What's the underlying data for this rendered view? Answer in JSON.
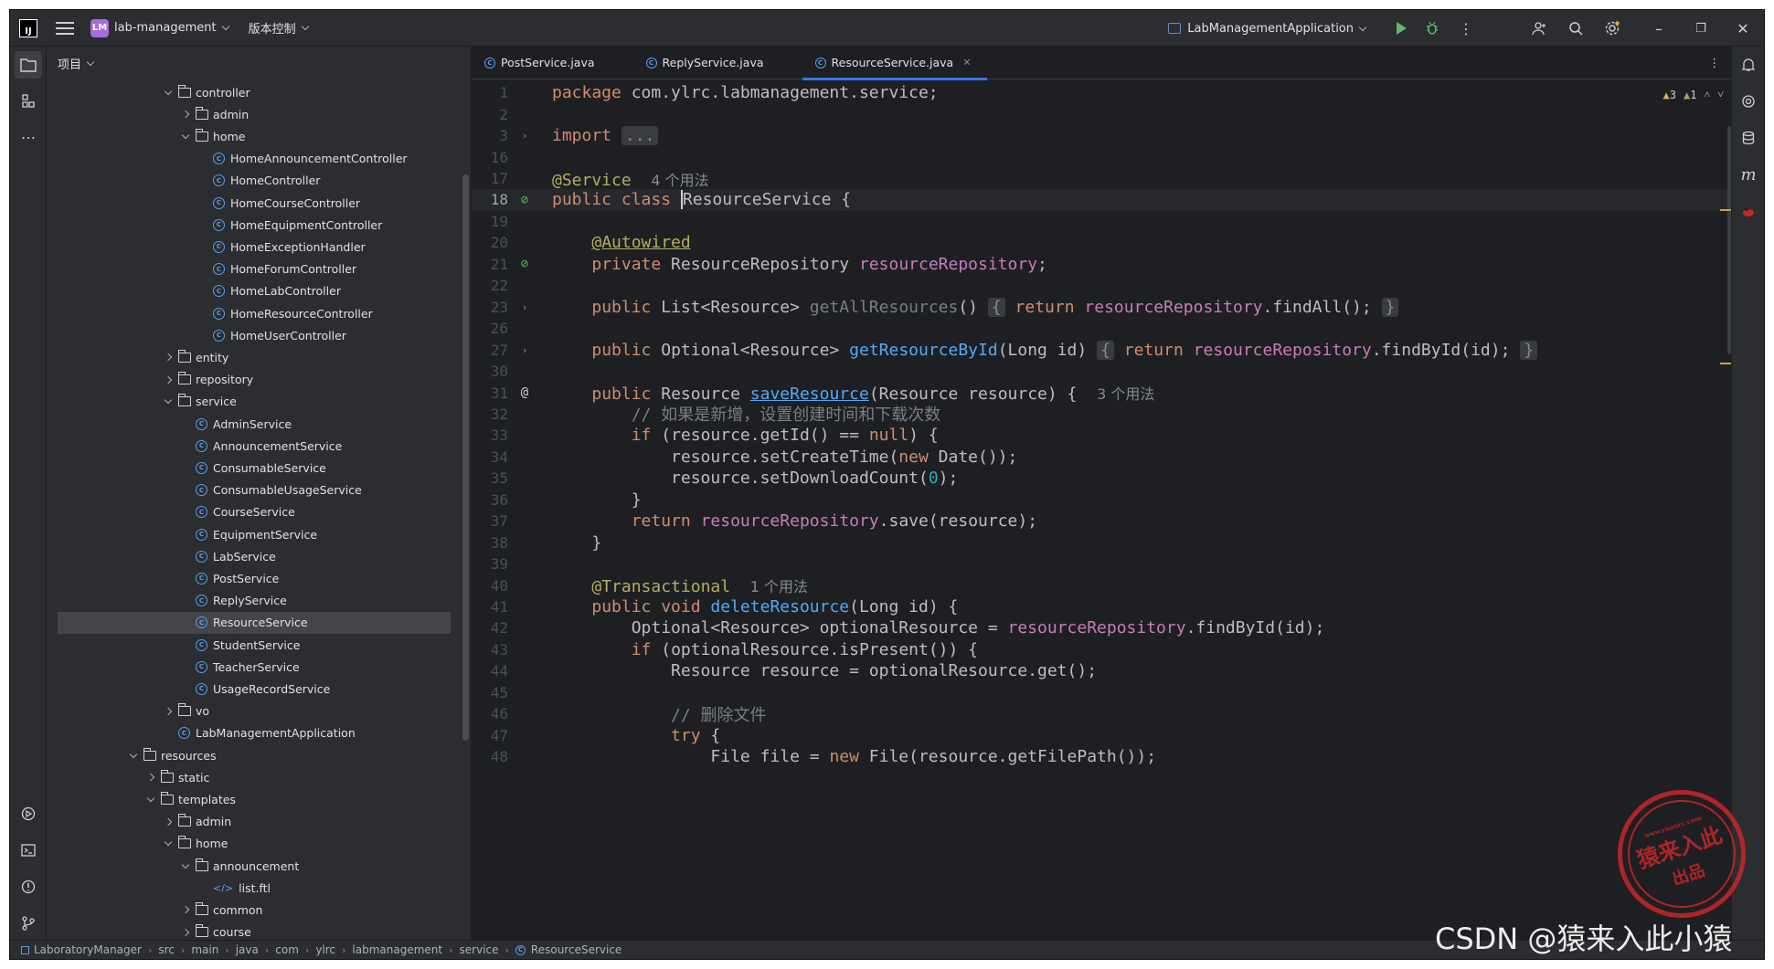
{
  "titlebar": {
    "app_logo": "IJ",
    "project_badge": "LM",
    "project_name": "lab-management",
    "vcs_menu": "版本控制",
    "run_config": "LabManagementApplication",
    "icons": [
      "menu-icon",
      "run-icon",
      "debug-icon",
      "more-icon",
      "user-icon",
      "search-icon",
      "settings-icon",
      "minimize-icon",
      "maximize-icon",
      "close-icon"
    ]
  },
  "project_panel": {
    "header": "项目",
    "tree": [
      {
        "label": "controller",
        "type": "folder",
        "depth": 2,
        "state": "open"
      },
      {
        "label": "admin",
        "type": "folder",
        "depth": 3,
        "state": "closed"
      },
      {
        "label": "home",
        "type": "folder",
        "depth": 3,
        "state": "open"
      },
      {
        "label": "HomeAnnouncementController",
        "type": "class",
        "depth": 4
      },
      {
        "label": "HomeController",
        "type": "class",
        "depth": 4
      },
      {
        "label": "HomeCourseController",
        "type": "class",
        "depth": 4
      },
      {
        "label": "HomeEquipmentController",
        "type": "class",
        "depth": 4
      },
      {
        "label": "HomeExceptionHandler",
        "type": "class",
        "depth": 4
      },
      {
        "label": "HomeForumController",
        "type": "class",
        "depth": 4
      },
      {
        "label": "HomeLabController",
        "type": "class",
        "depth": 4
      },
      {
        "label": "HomeResourceController",
        "type": "class",
        "depth": 4
      },
      {
        "label": "HomeUserController",
        "type": "class",
        "depth": 4
      },
      {
        "label": "entity",
        "type": "folder",
        "depth": 2,
        "state": "closed"
      },
      {
        "label": "repository",
        "type": "folder",
        "depth": 2,
        "state": "closed"
      },
      {
        "label": "service",
        "type": "folder",
        "depth": 2,
        "state": "open"
      },
      {
        "label": "AdminService",
        "type": "class",
        "depth": 3
      },
      {
        "label": "AnnouncementService",
        "type": "class",
        "depth": 3
      },
      {
        "label": "ConsumableService",
        "type": "class",
        "depth": 3
      },
      {
        "label": "ConsumableUsageService",
        "type": "class",
        "depth": 3
      },
      {
        "label": "CourseService",
        "type": "class",
        "depth": 3
      },
      {
        "label": "EquipmentService",
        "type": "class",
        "depth": 3
      },
      {
        "label": "LabService",
        "type": "class",
        "depth": 3
      },
      {
        "label": "PostService",
        "type": "class",
        "depth": 3
      },
      {
        "label": "ReplyService",
        "type": "class",
        "depth": 3
      },
      {
        "label": "ResourceService",
        "type": "class",
        "depth": 3,
        "selected": true
      },
      {
        "label": "StudentService",
        "type": "class",
        "depth": 3
      },
      {
        "label": "TeacherService",
        "type": "class",
        "depth": 3
      },
      {
        "label": "UsageRecordService",
        "type": "class",
        "depth": 3
      },
      {
        "label": "vo",
        "type": "folder",
        "depth": 2,
        "state": "closed"
      },
      {
        "label": "LabManagementApplication",
        "type": "app",
        "depth": 2
      },
      {
        "label": "resources",
        "type": "folder",
        "depth": 0,
        "state": "open"
      },
      {
        "label": "static",
        "type": "folder",
        "depth": 1,
        "state": "closed"
      },
      {
        "label": "templates",
        "type": "folder",
        "depth": 1,
        "state": "open"
      },
      {
        "label": "admin",
        "type": "folder",
        "depth": 2,
        "state": "closed"
      },
      {
        "label": "home",
        "type": "folder",
        "depth": 2,
        "state": "open"
      },
      {
        "label": "announcement",
        "type": "folder",
        "depth": 3,
        "state": "open"
      },
      {
        "label": "list.ftl",
        "type": "ftl",
        "depth": 4
      },
      {
        "label": "common",
        "type": "folder",
        "depth": 3,
        "state": "closed"
      },
      {
        "label": "course",
        "type": "folder",
        "depth": 3,
        "state": "closed"
      }
    ]
  },
  "editor": {
    "tabs": [
      {
        "label": "PostService.java",
        "active": false
      },
      {
        "label": "ReplyService.java",
        "active": false
      },
      {
        "label": "ResourceService.java",
        "active": true
      }
    ],
    "inspections": {
      "warnings": "3",
      "weak_warnings": "1"
    },
    "lines": [
      {
        "n": "1",
        "html": "<span class=\"kw\">package</span> com.ylrc.labmanagement.service;"
      },
      {
        "n": "2",
        "html": ""
      },
      {
        "n": "3",
        "html": "<span class=\"kw\">import</span> <span class=\"fblk\">...</span>",
        "gutter": "fold"
      },
      {
        "n": "16",
        "html": ""
      },
      {
        "n": "17",
        "html": "<span class=\"ann\">@Service</span>  <span class=\"hint\">4 个用法</span>"
      },
      {
        "n": "18",
        "html": "<span class=\"kw\">public class</span> <span class=\"caret\"></span>ResourceService {",
        "gutter": "bean",
        "current": true
      },
      {
        "n": "19",
        "html": ""
      },
      {
        "n": "20",
        "html": "    <span class=\"ann uline\">@Autowired</span>"
      },
      {
        "n": "21",
        "html": "    <span class=\"kw\">private</span> ResourceRepository <span class=\"fld\">resourceRepository</span>;",
        "gutter": "bean"
      },
      {
        "n": "22",
        "html": ""
      },
      {
        "n": "23",
        "html": "    <span class=\"kw\">public</span> List&lt;Resource&gt; <span class=\"cmt\">getAllResources</span>() <span class=\"fblk\">{</span> <span class=\"kw\">return</span> <span class=\"fld\">resourceRepository</span>.findAll(); <span class=\"fblk\">}</span>",
        "gutter": "fold"
      },
      {
        "n": "26",
        "html": ""
      },
      {
        "n": "27",
        "html": "    <span class=\"kw\">public</span> Optional&lt;Resource&gt; <span class=\"fn\">getResourceById</span>(Long id) <span class=\"fblk\">{</span> <span class=\"kw\">return</span> <span class=\"fld\">resourceRepository</span>.findById(id); <span class=\"fblk\">}</span>",
        "gutter": "fold"
      },
      {
        "n": "30",
        "html": ""
      },
      {
        "n": "31",
        "html": "    <span class=\"kw\">public</span> Resource <span class=\"fn uline\">saveResource</span>(Resource resource) {  <span class=\"hint\">3 个用法</span>",
        "gutter": "at"
      },
      {
        "n": "32",
        "html": "        <span class=\"cmt\">// 如果是新增，设置创建时间和下载次数</span>"
      },
      {
        "n": "33",
        "html": "        <span class=\"kw\">if</span> (resource.getId() == <span class=\"kw\">null</span>) {"
      },
      {
        "n": "34",
        "html": "            resource.setCreateTime(<span class=\"kw\">new</span> Date());"
      },
      {
        "n": "35",
        "html": "            resource.setDownloadCount(<span class=\"num\">0</span>);"
      },
      {
        "n": "36",
        "html": "        }"
      },
      {
        "n": "37",
        "html": "        <span class=\"kw\">return</span> <span class=\"fld\">resourceRepository</span>.save(resource);"
      },
      {
        "n": "38",
        "html": "    }"
      },
      {
        "n": "39",
        "html": ""
      },
      {
        "n": "40",
        "html": "    <span class=\"ann\">@Transactional</span>  <span class=\"hint\">1 个用法</span>"
      },
      {
        "n": "41",
        "html": "    <span class=\"kw\">public void</span> <span class=\"fn\">deleteResource</span>(Long id) {"
      },
      {
        "n": "42",
        "html": "        Optional&lt;Resource&gt; optionalResource = <span class=\"fld\">resourceRepository</span>.findById(id);"
      },
      {
        "n": "43",
        "html": "        <span class=\"kw\">if</span> (optionalResource.isPresent()) {"
      },
      {
        "n": "44",
        "html": "            Resource resource = optionalResource.get();"
      },
      {
        "n": "45",
        "html": ""
      },
      {
        "n": "46",
        "html": "            <span class=\"cmt\">// 删除文件</span>"
      },
      {
        "n": "47",
        "html": "            <span class=\"kw\">try</span> {"
      },
      {
        "n": "48",
        "html": "                File file = <span class=\"kw\">new</span> File(resource.getFilePath());"
      }
    ]
  },
  "statusbar": {
    "breadcrumbs": [
      "LaboratoryManager",
      "src",
      "main",
      "java",
      "com",
      "ylrc",
      "labmanagement",
      "service",
      "ResourceService"
    ]
  },
  "watermark": {
    "stamp_main": "猿来入此",
    "stamp_sub": "出品",
    "stamp_url": "www.yuanrc.com",
    "csdn": "CSDN @猿来入此小猿"
  }
}
